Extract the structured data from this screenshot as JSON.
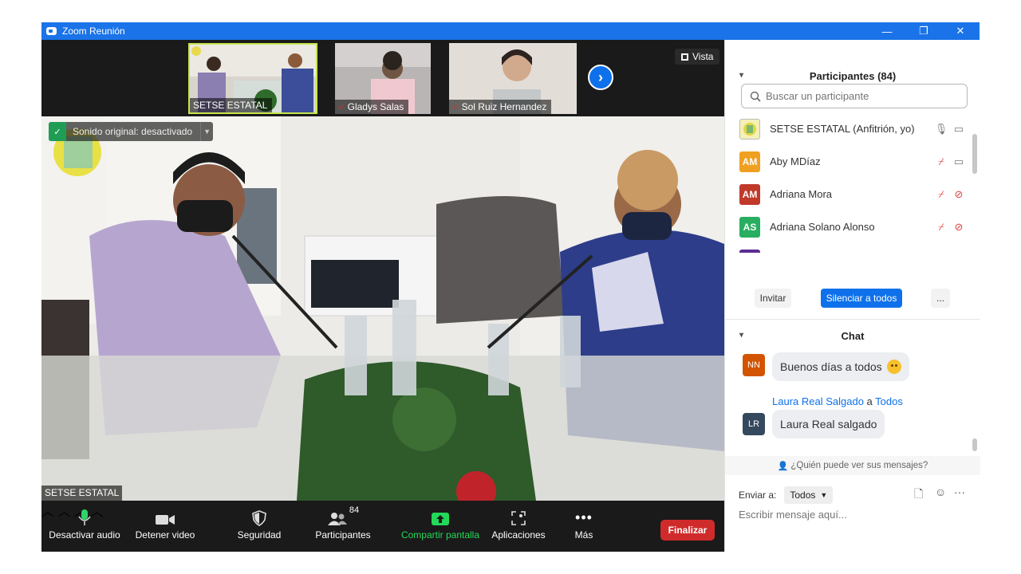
{
  "window": {
    "title": "Zoom Reunión",
    "minimize_glyph": "—",
    "restore_glyph": "❐",
    "close_glyph": "✕"
  },
  "thumbnails": [
    {
      "name": "SETSE ESTATAL",
      "muted": false,
      "active": true
    },
    {
      "name": "Gladys Salas",
      "muted": true,
      "active": false
    },
    {
      "name": "Sol Ruiz Hernandez",
      "muted": true,
      "active": false
    }
  ],
  "view_button": {
    "label": "Vista"
  },
  "main_video": {
    "sound_banner": "Sonido original: desactivado",
    "speaker_name": "SETSE ESTATAL"
  },
  "toolbar": {
    "mute_label": "Desactivar audio",
    "video_label": "Detener video",
    "security_label": "Seguridad",
    "participants_label": "Participantes",
    "participants_count": "84",
    "share_label": "Compartir pantalla",
    "apps_label": "Aplicaciones",
    "more_label": "Más",
    "end_label": "Finalizar"
  },
  "participants_panel": {
    "title": "Participantes (84)",
    "search_placeholder": "Buscar un participante",
    "rows": [
      {
        "initials": "",
        "name": "SETSE ESTATAL (Anfitrión, yo)",
        "color": "#2e7d32"
      },
      {
        "initials": "AM",
        "name": "Aby MDíaz",
        "color": "#f0a020"
      },
      {
        "initials": "AM",
        "name": "Adriana Mora",
        "color": "#c0392b"
      },
      {
        "initials": "AS",
        "name": "Adriana Solano Alonso",
        "color": "#27ae60"
      }
    ],
    "invite_label": "Invitar",
    "mute_all_label": "Silenciar a todos",
    "more_label": "..."
  },
  "chat_panel": {
    "title": "Chat",
    "messages": [
      {
        "initials": "NN",
        "color": "#d35400",
        "text": "Buenos días a todos"
      },
      {
        "initials": "LR",
        "color": "#34495e",
        "text": "Laura Real salgado"
      }
    ],
    "sender_name": "Laura Real Salgado",
    "sender_connector": "a",
    "sender_target": "Todos",
    "who_can_see": "¿Quién puede ver sus mensajes?",
    "send_to_label": "Enviar a:",
    "send_to_value": "Todos",
    "message_placeholder": "Escribir mensaje aquí..."
  },
  "colors": {
    "accent": "#0e71eb",
    "titlebar": "#1a73e8",
    "end_button": "#d02b2b",
    "share_green": "#23d959",
    "muted_red": "#e23d3d"
  }
}
